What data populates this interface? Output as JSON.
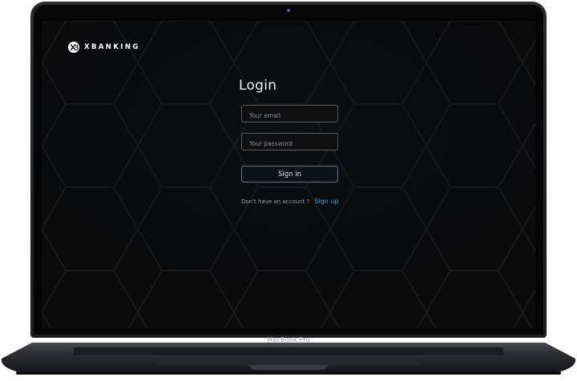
{
  "device": {
    "model_label": "MacBook Pro"
  },
  "app": {
    "brand": {
      "name": "XBANKING",
      "logo_icon": "xb-logo-icon"
    },
    "login": {
      "title": "Login",
      "email_placeholder": "Your email",
      "password_placeholder": "Your password",
      "signin_label": "Sign in",
      "no_account_text": "Don't have an account ?",
      "signup_label": "Sign up"
    }
  },
  "colors": {
    "accent": "#3fa3d6",
    "screen_bg": "#0b0b0c",
    "button_border": "#2f88b5"
  }
}
